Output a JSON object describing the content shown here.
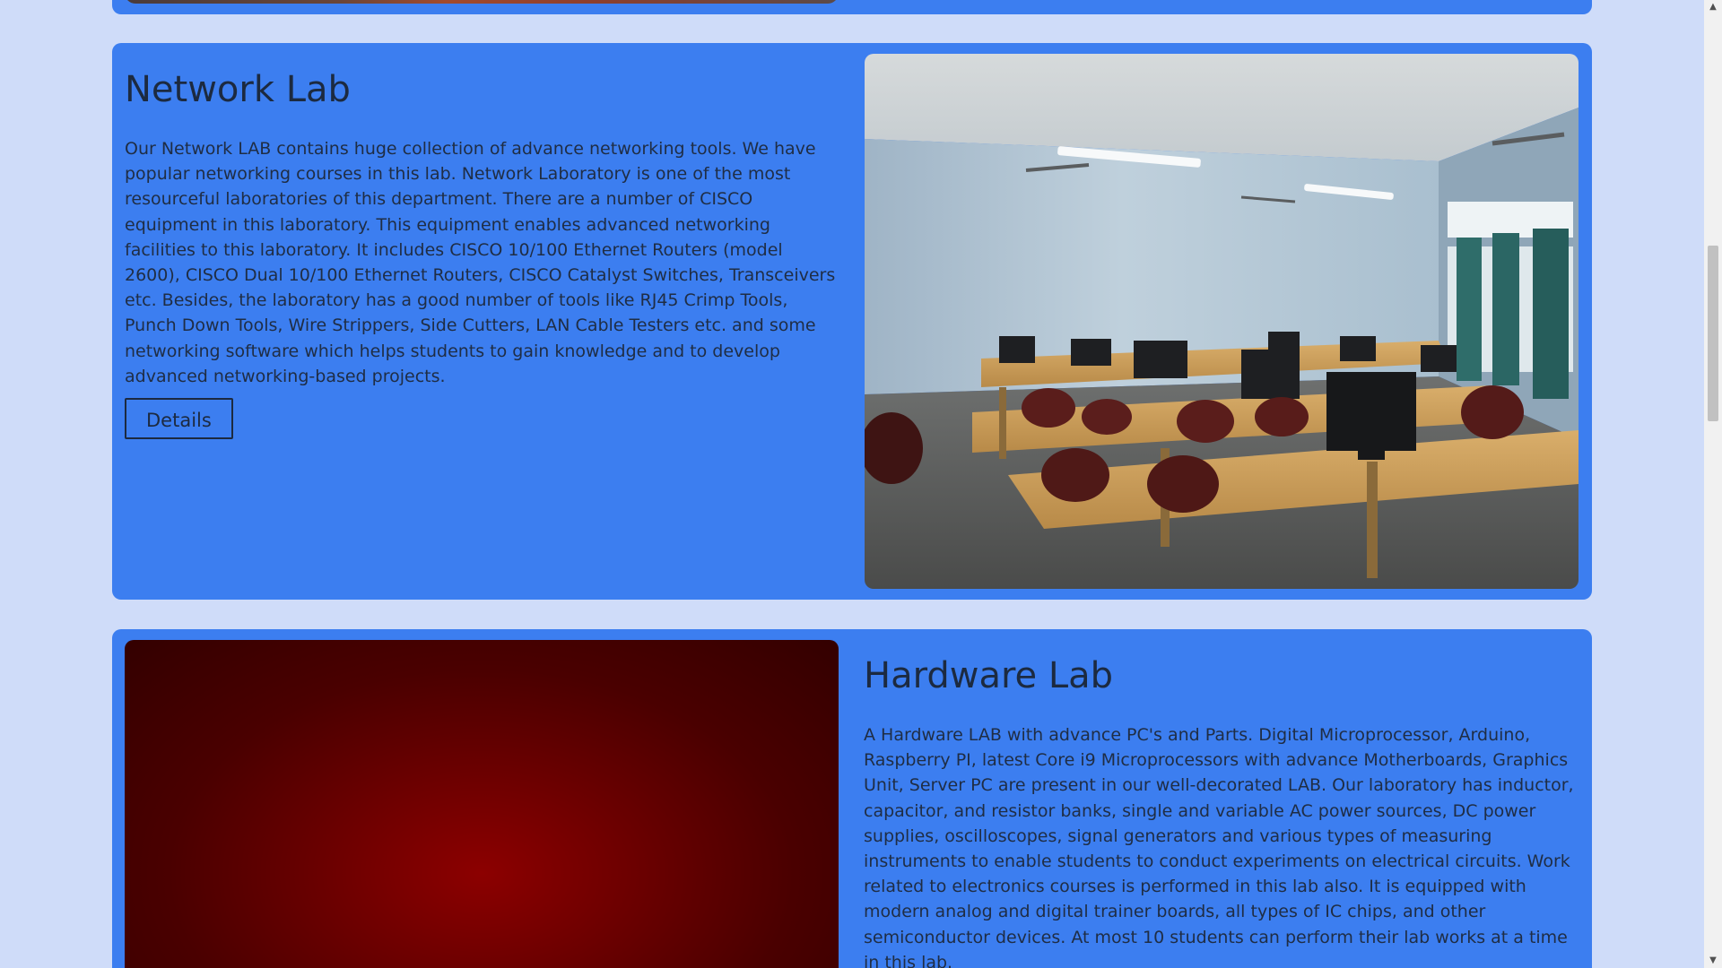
{
  "labs": [
    {
      "title": "Network Lab",
      "description": "Our Network LAB contains huge collection of advance networking tools. We have popular networking courses in this lab. Network Laboratory is one of the most resourceful laboratories of this department. There are a number of CISCO equipment in this laboratory. This equipment enables advanced networking facilities to this laboratory. It includes CISCO 10/100 Ethernet Routers (model 2600), CISCO Dual 10/100 Ethernet Routers, CISCO Catalyst Switches, Transceivers etc. Besides, the laboratory has a good number of tools like RJ45 Crimp Tools, Punch Down Tools, Wire Strippers, Side Cutters, LAN Cable Testers etc. and some networking software which helps students to gain knowledge and to develop advanced networking-based projects.",
      "button_label": "Details"
    },
    {
      "title": "Hardware Lab",
      "description": "A Hardware LAB with advance PC's and Parts. Digital Microprocessor, Arduino, Raspberry PI, latest Core i9 Microprocessors with advance Motherboards, Graphics Unit, Server PC are present in our well-decorated LAB. Our laboratory has inductor, capacitor, and resistor banks, single and variable AC power sources, DC power supplies, oscilloscopes, signal generators and various types of measuring instruments to enable students to conduct experiments on electrical circuits. Work related to electronics courses is performed in this lab also. It is equipped with modern analog and digital trainer boards, all types of IC chips, and other semiconductor devices. At most 10 students can perform their lab works at a time in this lab."
    }
  ],
  "scrollbar": {
    "up_arrow": "▲",
    "down_arrow": "▼"
  }
}
